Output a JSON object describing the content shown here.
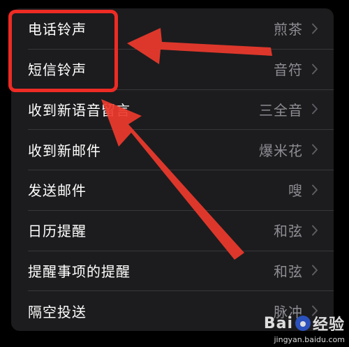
{
  "settings": {
    "rows": [
      {
        "label": "电话铃声",
        "value": "煎茶"
      },
      {
        "label": "短信铃声",
        "value": "音符"
      },
      {
        "label": "收到新语音留言",
        "value": "三全音"
      },
      {
        "label": "收到新邮件",
        "value": "爆米花"
      },
      {
        "label": "发送邮件",
        "value": "嗖"
      },
      {
        "label": "日历提醒",
        "value": "和弦"
      },
      {
        "label": "提醒事项的提醒",
        "value": "和弦"
      },
      {
        "label": "隔空投送",
        "value": "脉冲"
      }
    ]
  },
  "watermark": {
    "logo_left": "Bai",
    "logo_right": "经验",
    "url": "jingyan.baidu.com"
  },
  "colors": {
    "background": "#000000",
    "card": "#1c1c1e",
    "separator": "#38383a",
    "label": "#ffffff",
    "value": "#8d8d93",
    "annotation": "#ee2b24"
  },
  "icons": {
    "chevron": "chevron-right-icon",
    "watermark_paw": "baidu-paw-icon"
  }
}
